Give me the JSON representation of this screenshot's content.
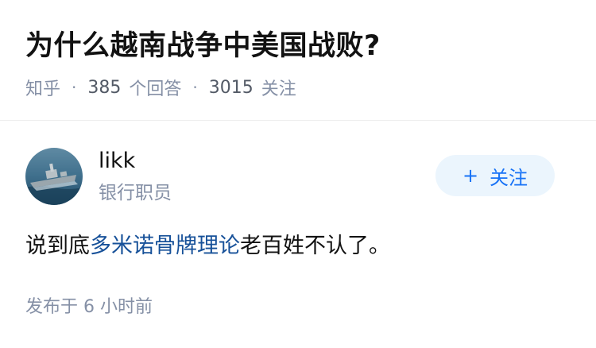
{
  "question": {
    "title": "为什么越南战争中美国战败?"
  },
  "meta": {
    "source": "知乎",
    "answer_count": "385",
    "answer_unit": "个回答",
    "follow_count": "3015",
    "follow_unit": "关注"
  },
  "author": {
    "name": "likk",
    "role": "银行职员",
    "avatar_icon": "warship-avatar"
  },
  "follow_button": {
    "plus": "+",
    "label": "关注"
  },
  "answer": {
    "text_before": "说到底",
    "link_text": "多米诺骨牌理论",
    "text_after": "老百姓不认了。"
  },
  "publish": {
    "label": "发布于",
    "time": "6 小时前"
  },
  "colors": {
    "link": "#175199",
    "follow_text": "#1772f6",
    "follow_bg": "#ebf5fd",
    "muted": "#8590a6"
  }
}
